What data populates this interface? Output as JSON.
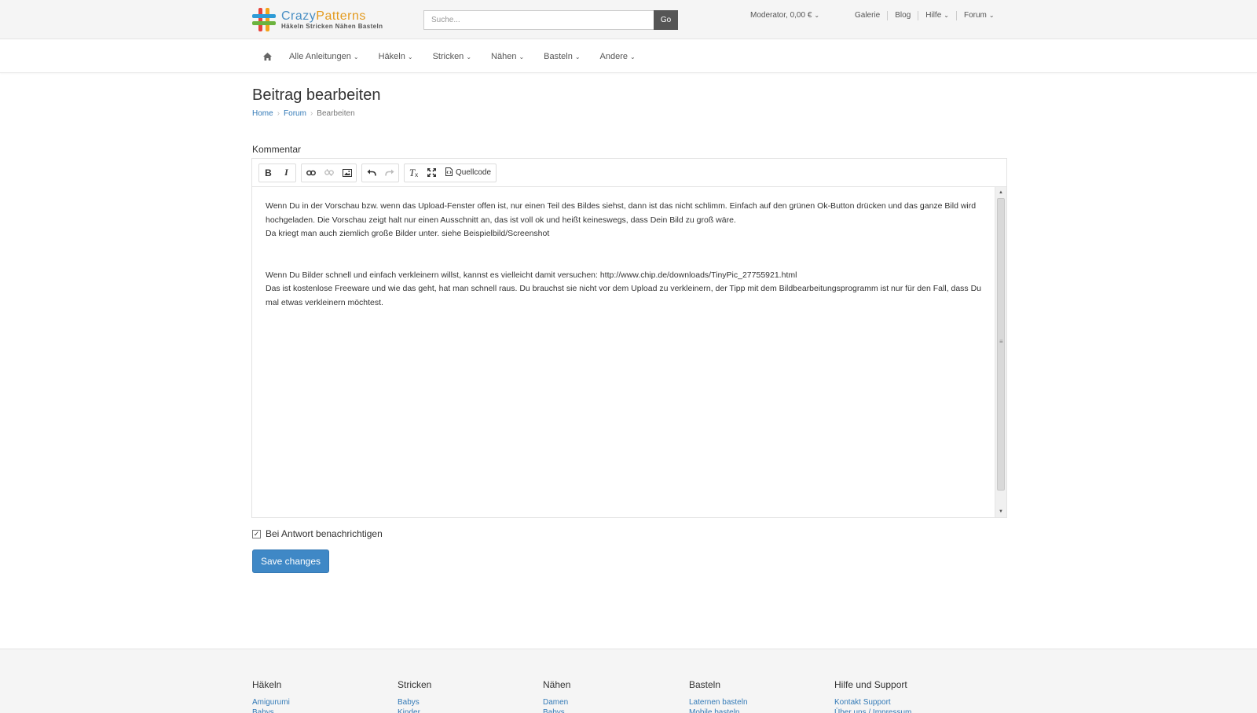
{
  "brand": {
    "name_part1": "Crazy",
    "name_part2": "Patterns",
    "tagline": "Häkeln Stricken Nähen Basteln",
    "colors": [
      "#e8423a",
      "#f4a31a",
      "#2e9bd6",
      "#6cb33e"
    ]
  },
  "search": {
    "placeholder": "Suche...",
    "go_label": "Go"
  },
  "account": {
    "label": "Moderator, 0,00 €"
  },
  "top_links": [
    {
      "label": "Galerie",
      "dropdown": false
    },
    {
      "label": "Blog",
      "dropdown": false
    },
    {
      "label": "Hilfe",
      "dropdown": true
    },
    {
      "label": "Forum",
      "dropdown": true
    }
  ],
  "category_nav": {
    "home_icon": "home-icon",
    "items": [
      "Alle Anleitungen",
      "Häkeln",
      "Stricken",
      "Nähen",
      "Basteln",
      "Andere"
    ]
  },
  "page": {
    "title": "Beitrag bearbeiten",
    "breadcrumb": [
      "Home",
      "Forum",
      "Bearbeiten"
    ]
  },
  "form": {
    "comment_label": "Kommentar",
    "toolbar": {
      "groups": [
        [
          "bold-icon",
          "italic-icon"
        ],
        [
          "link-icon",
          "unlink-icon",
          "image-icon"
        ],
        [
          "undo-icon",
          "redo-icon"
        ],
        [
          "clear-format-icon",
          "fullscreen-icon",
          "source-code-icon"
        ]
      ],
      "source_label": "Quellcode"
    },
    "content": {
      "p1": "Wenn Du in der Vorschau bzw. wenn das Upload-Fenster offen ist, nur einen Teil des Bildes siehst, dann ist das nicht schlimm. Einfach auf den grünen Ok-Button drücken und das ganze Bild wird hochgeladen. Die Vorschau zeigt halt nur einen Ausschnitt an, das ist voll ok und heißt keineswegs, dass Dein Bild zu groß wäre.",
      "p2": "Da kriegt man auch ziemlich große Bilder unter. siehe Beispielbild/Screenshot",
      "p3": "Wenn Du Bilder schnell und einfach verkleinern willst, kannst es vielleicht damit versuchen: http://www.chip.de/downloads/TinyPic_27755921.html",
      "p4": "Das ist kostenlose Freeware und wie das geht, hat man schnell raus. Du brauchst sie nicht vor dem Upload zu verkleinern, der Tipp mit dem Bildbearbeitungsprogramm ist nur für den Fall, dass Du mal etwas verkleinern möchtest."
    },
    "notify_label": "Bei Antwort benachrichtigen",
    "notify_checked": true,
    "save_label": "Save changes"
  },
  "footer": {
    "columns": [
      {
        "title": "Häkeln",
        "links": [
          "Amigurumi",
          "Babys"
        ]
      },
      {
        "title": "Stricken",
        "links": [
          "Babys",
          "Kinder"
        ]
      },
      {
        "title": "Nähen",
        "links": [
          "Damen",
          "Babys"
        ]
      },
      {
        "title": "Basteln",
        "links": [
          "Laternen basteln",
          "Mobile basteln"
        ]
      },
      {
        "title": "Hilfe und Support",
        "links": [
          "Kontakt Support",
          "Über uns / Impressum"
        ]
      }
    ]
  },
  "colors": {
    "accent": "#3f88c6",
    "link": "#337ab7",
    "go_button": "#555555"
  }
}
